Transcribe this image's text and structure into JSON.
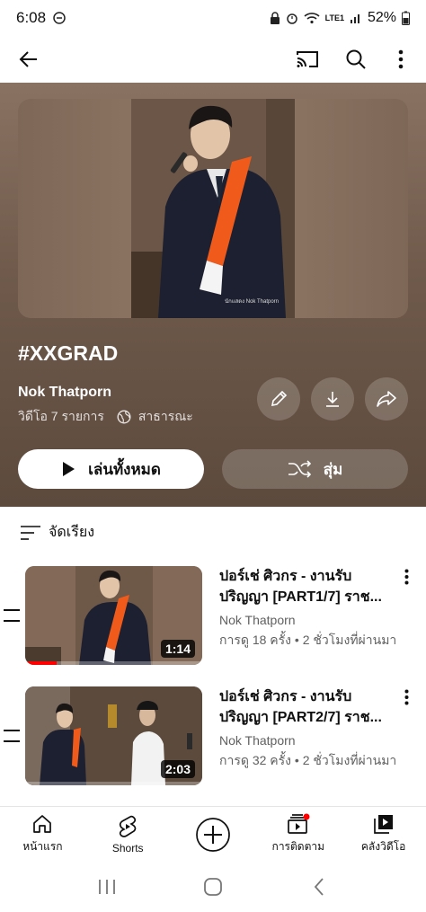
{
  "status_bar": {
    "time": "6:08",
    "network": "LTE1",
    "battery": "52%",
    "icons": [
      "do-not-disturb-icon",
      "alarm-icon",
      "wifi-icon",
      "signal-icon",
      "battery-icon"
    ]
  },
  "app_bar": {
    "icons": [
      "back-arrow-icon",
      "cast-icon",
      "search-icon",
      "more-vert-icon"
    ]
  },
  "playlist": {
    "title": "#XXGRAD",
    "owner": "Nok Thatporn",
    "video_count": "วิดีโอ 7 รายการ",
    "visibility": "สาธารณะ",
    "play_all_label": "เล่นทั้งหมด",
    "shuffle_label": "สุ่ม",
    "photo_caption": "นักแสดง Nok Thatporn"
  },
  "sort": {
    "label": "จัดเรียง"
  },
  "videos": [
    {
      "title": "ปอร์เช่ ศิวกร - งานรับปริญญา [PART1/7] ราช...",
      "channel": "Nok Thatporn",
      "stats": "การดู 18 ครั้ง • 2 ชั่วโมงที่ผ่านมา",
      "duration": "1:14",
      "progress": 0.18
    },
    {
      "title": "ปอร์เช่ ศิวกร - งานรับปริญญา [PART2/7] ราช...",
      "channel": "Nok Thatporn",
      "stats": "การดู 32 ครั้ง • 2 ชั่วโมงที่ผ่านมา",
      "duration": "2:03",
      "progress": 0.0
    }
  ],
  "bottom_nav": {
    "home": "หน้าแรก",
    "shorts": "Shorts",
    "subscriptions": "การติดตาม",
    "library": "คลังวิดีโอ"
  },
  "colors": {
    "accent_red": "#ff0000",
    "hero_bg": "#6f5a4b",
    "sash_orange": "#f05a1a"
  }
}
